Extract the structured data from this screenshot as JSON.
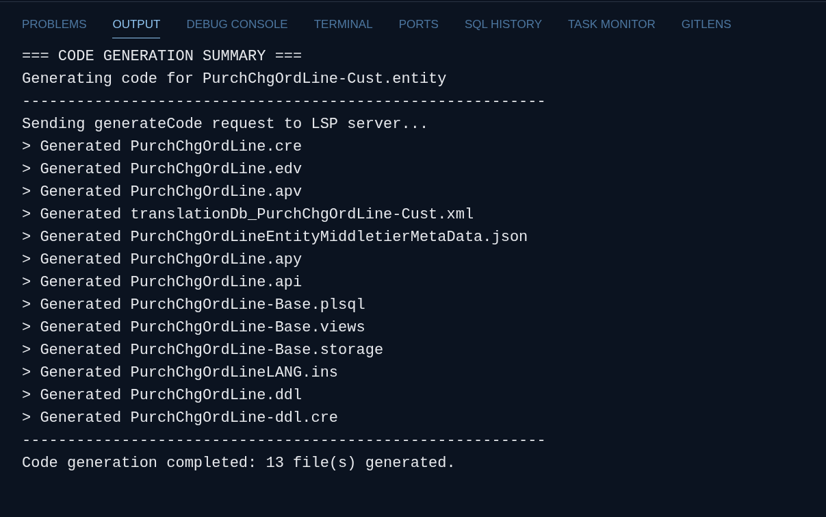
{
  "tabs": [
    {
      "label": "PROBLEMS",
      "selected": false
    },
    {
      "label": "OUTPUT",
      "selected": true
    },
    {
      "label": "DEBUG CONSOLE",
      "selected": false
    },
    {
      "label": "TERMINAL",
      "selected": false
    },
    {
      "label": "PORTS",
      "selected": false
    },
    {
      "label": "SQL HISTORY",
      "selected": false
    },
    {
      "label": "TASK MONITOR",
      "selected": false
    },
    {
      "label": "GITLENS",
      "selected": false
    }
  ],
  "output_lines": [
    "=== CODE GENERATION SUMMARY ===",
    "Generating code for PurchChgOrdLine-Cust.entity",
    "----------------------------------------------------------",
    "Sending generateCode request to LSP server...",
    "> Generated PurchChgOrdLine.cre",
    "> Generated PurchChgOrdLine.edv",
    "> Generated PurchChgOrdLine.apv",
    "> Generated translationDb_PurchChgOrdLine-Cust.xml",
    "> Generated PurchChgOrdLineEntityMiddletierMetaData.json",
    "> Generated PurchChgOrdLine.apy",
    "> Generated PurchChgOrdLine.api",
    "> Generated PurchChgOrdLine-Base.plsql",
    "> Generated PurchChgOrdLine-Base.views",
    "> Generated PurchChgOrdLine-Base.storage",
    "> Generated PurchChgOrdLineLANG.ins",
    "> Generated PurchChgOrdLine.ddl",
    "> Generated PurchChgOrdLine-ddl.cre",
    "----------------------------------------------------------",
    "Code generation completed: 13 file(s) generated."
  ]
}
